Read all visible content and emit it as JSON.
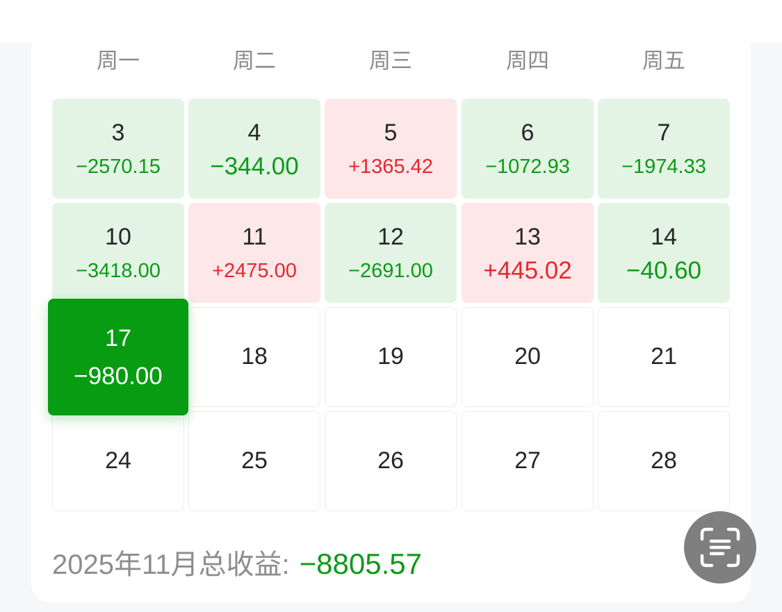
{
  "weekdays": [
    "周一",
    "周二",
    "周三",
    "周四",
    "周五"
  ],
  "weeks": [
    [
      {
        "day": "3",
        "value": "−2570.15",
        "type": "neg"
      },
      {
        "day": "4",
        "value": "−344.00",
        "type": "neg",
        "big": true
      },
      {
        "day": "5",
        "value": "+1365.42",
        "type": "pos"
      },
      {
        "day": "6",
        "value": "−1072.93",
        "type": "neg"
      },
      {
        "day": "7",
        "value": "−1974.33",
        "type": "neg"
      }
    ],
    [
      {
        "day": "10",
        "value": "−3418.00",
        "type": "neg"
      },
      {
        "day": "11",
        "value": "+2475.00",
        "type": "pos"
      },
      {
        "day": "12",
        "value": "−2691.00",
        "type": "neg"
      },
      {
        "day": "13",
        "value": "+445.02",
        "type": "pos",
        "big": true
      },
      {
        "day": "14",
        "value": "−40.60",
        "type": "neg",
        "big": true
      }
    ],
    [
      {
        "day": "17",
        "value": "−980.00",
        "type": "selected"
      },
      {
        "day": "18",
        "value": "",
        "type": "empty"
      },
      {
        "day": "19",
        "value": "",
        "type": "empty"
      },
      {
        "day": "20",
        "value": "",
        "type": "empty"
      },
      {
        "day": "21",
        "value": "",
        "type": "empty"
      }
    ],
    [
      {
        "day": "24",
        "value": "",
        "type": "empty"
      },
      {
        "day": "25",
        "value": "",
        "type": "empty"
      },
      {
        "day": "26",
        "value": "",
        "type": "empty"
      },
      {
        "day": "27",
        "value": "",
        "type": "empty"
      },
      {
        "day": "28",
        "value": "",
        "type": "empty"
      }
    ]
  ],
  "summary": {
    "label": "2025年11月总收益:",
    "total": "−8805.57"
  },
  "colors": {
    "negative": "#0d9a17",
    "positive": "#e4292f",
    "selected": "#079c12"
  },
  "scan_button": {
    "icon": "scan-text-icon"
  }
}
